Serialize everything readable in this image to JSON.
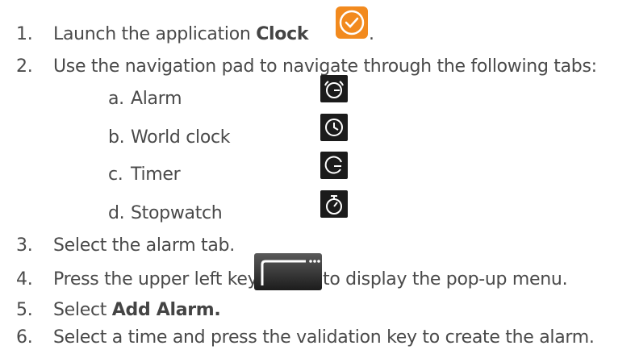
{
  "steps": [
    {
      "num": "1.",
      "prefix": "Launch the application ",
      "bold": "Clock",
      "suffix": "."
    },
    {
      "num": "2.",
      "text": "Use the navigation pad to navigate through the following tabs:"
    },
    {
      "num": "3.",
      "text": "Select the alarm tab."
    },
    {
      "num": "4.",
      "prefix": "Press the upper left key ",
      "suffix": " to display the pop-up menu."
    },
    {
      "num": "5.",
      "prefix": "Select ",
      "bold": "Add Alarm."
    },
    {
      "num": "6.",
      "text": "Select a time and press the validation key to create the alarm."
    }
  ],
  "tabs": [
    {
      "letter": "a.",
      "label": "Alarm",
      "icon": "alarm-icon"
    },
    {
      "letter": "b.",
      "label": "World clock",
      "icon": "world-clock-icon"
    },
    {
      "letter": "c.",
      "label": "Timer",
      "icon": "timer-icon"
    },
    {
      "letter": "d.",
      "label": "Stopwatch",
      "icon": "stopwatch-icon"
    }
  ],
  "colors": {
    "text": "#4a4a4a",
    "clock_icon": "#f28a1e",
    "tab_icon_bg": "#1b1b1b"
  }
}
